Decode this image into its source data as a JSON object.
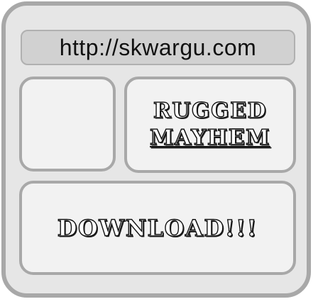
{
  "address_bar": {
    "url": "http://skwargu.com"
  },
  "title_panel": {
    "line1": "RUGGED",
    "line2": "MAYHEM"
  },
  "download_panel": {
    "label": "DOWNLOAD!!!"
  }
}
